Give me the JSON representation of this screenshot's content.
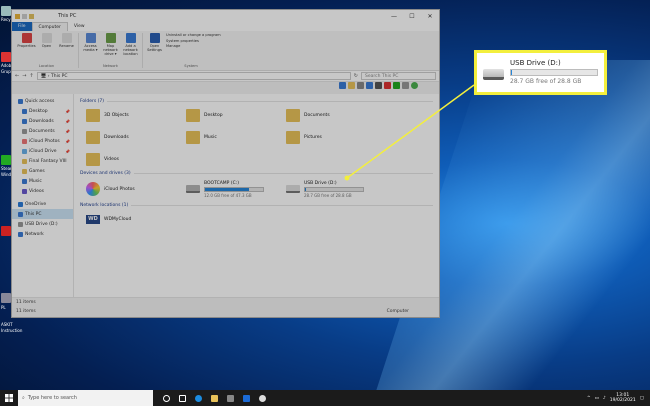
{
  "window": {
    "title": "This PC",
    "controls": {
      "minimize": "—",
      "maximize": "☐",
      "close": "✕"
    }
  },
  "tabs": [
    "File",
    "Computer",
    "View"
  ],
  "ribbon": {
    "location": {
      "label": "Location",
      "items": [
        "Properties",
        "Open",
        "Rename"
      ]
    },
    "network": {
      "label": "Network",
      "items": [
        "Access media ▾",
        "Map network drive ▾",
        "Add a network location"
      ]
    },
    "system": {
      "label": "System",
      "open_settings": "Open Settings",
      "links": [
        "Uninstall or change a program",
        "System properties",
        "Manage"
      ]
    }
  },
  "address": {
    "path": "This PC",
    "search_placeholder": "Search This PC"
  },
  "nav_pane": {
    "quick_access": "Quick access",
    "items": [
      "Desktop",
      "Downloads",
      "Documents",
      "iCloud Photos",
      "iCloud Drive",
      "Final Fantasy VIII",
      "Games",
      "Music",
      "Videos"
    ],
    "onedrive": "OneDrive",
    "this_pc": "This PC",
    "usb": "USB Drive (D:)",
    "network": "Network"
  },
  "folders": {
    "header": "Folders (7)",
    "items": [
      "3D Objects",
      "Desktop",
      "Documents",
      "Downloads",
      "Music",
      "Pictures",
      "Videos"
    ]
  },
  "devices": {
    "header": "Devices and drives (3)",
    "items": [
      {
        "name": "iCloud Photos",
        "sub": "",
        "fill": 0
      },
      {
        "name": "BOOTCAMP (C:)",
        "sub": "12.0 GB free of 47.3 GB",
        "fill": 0.75
      },
      {
        "name": "USB Drive (D:)",
        "sub": "28.7 GB free of 28.8 GB",
        "fill": 0.01
      }
    ]
  },
  "network_locations": {
    "header": "Network locations (1)",
    "items": [
      "WDMyCloud"
    ]
  },
  "status": {
    "count": "11 items",
    "count2": "11 items",
    "computer": "Computer"
  },
  "callout": {
    "title": "USB Drive (D:)",
    "sub": "28.7 GB free of 28.8 GB",
    "fill": 0.01
  },
  "taskbar": {
    "search": "Type here to search",
    "time": "13:01",
    "date": "19/02/2021"
  },
  "desktop_labels": [
    "Recy",
    "Adob",
    "Grup",
    "Steam",
    "Wind",
    "PL",
    "ASKIT",
    "Instruction"
  ],
  "colors": {
    "accent": "#1a6ac2",
    "callout_border": "#f3ef3d",
    "bar": "#2686d9"
  }
}
